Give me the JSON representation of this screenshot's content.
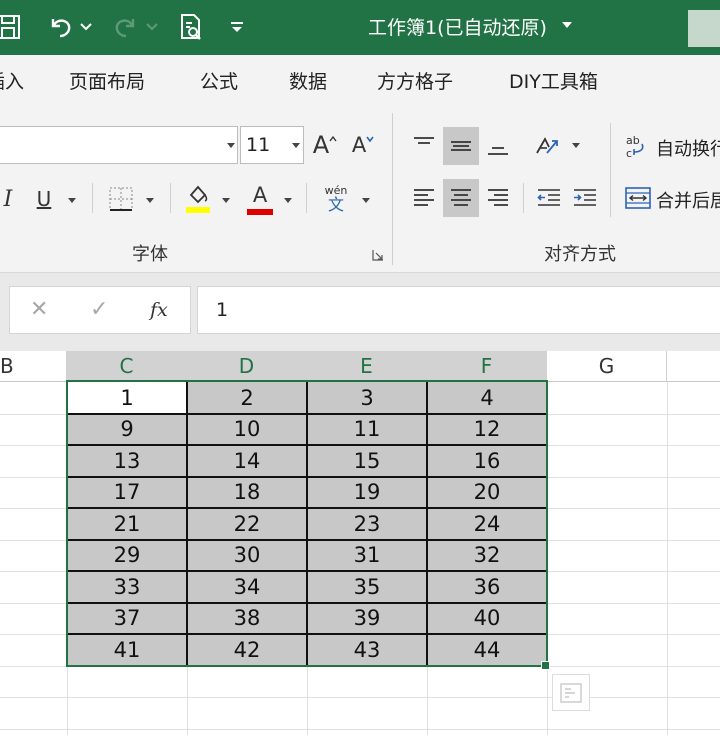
{
  "titlebar": {
    "doc_title": "工作簿1(已自动还原)",
    "bg_color": "#217346"
  },
  "ribbon_tabs": [
    {
      "label": "插入"
    },
    {
      "label": "页面布局"
    },
    {
      "label": "公式"
    },
    {
      "label": "数据"
    },
    {
      "label": "方方格子"
    },
    {
      "label": "DIY工具箱"
    }
  ],
  "ribbon": {
    "font_size": "11",
    "font_group_label": "字体",
    "align_group_label": "对齐方式",
    "wrap_text_label": "自动换行",
    "merge_center_label": "合并后居中",
    "underline_glyph": "U",
    "italic_glyph": "I",
    "grow_font_glyph": "A",
    "shrink_font_glyph": "A",
    "font_color_glyph": "A",
    "phonetic_glyph": "wén",
    "phonetic_sub": "文",
    "highlight_color": "#ffff00",
    "font_color": "#e00000"
  },
  "formula_bar": {
    "fx": "fx",
    "value": "1"
  },
  "columns": [
    {
      "label": "B",
      "selected": false
    },
    {
      "label": "C",
      "selected": true
    },
    {
      "label": "D",
      "selected": true
    },
    {
      "label": "E",
      "selected": true
    },
    {
      "label": "F",
      "selected": true
    },
    {
      "label": "G",
      "selected": false
    }
  ],
  "table": [
    [
      "1",
      "2",
      "3",
      "4"
    ],
    [
      "9",
      "10",
      "11",
      "12"
    ],
    [
      "13",
      "14",
      "15",
      "16"
    ],
    [
      "17",
      "18",
      "19",
      "20"
    ],
    [
      "21",
      "22",
      "23",
      "24"
    ],
    [
      "29",
      "30",
      "31",
      "32"
    ],
    [
      "33",
      "34",
      "35",
      "36"
    ],
    [
      "37",
      "38",
      "39",
      "40"
    ],
    [
      "41",
      "42",
      "43",
      "44"
    ]
  ]
}
